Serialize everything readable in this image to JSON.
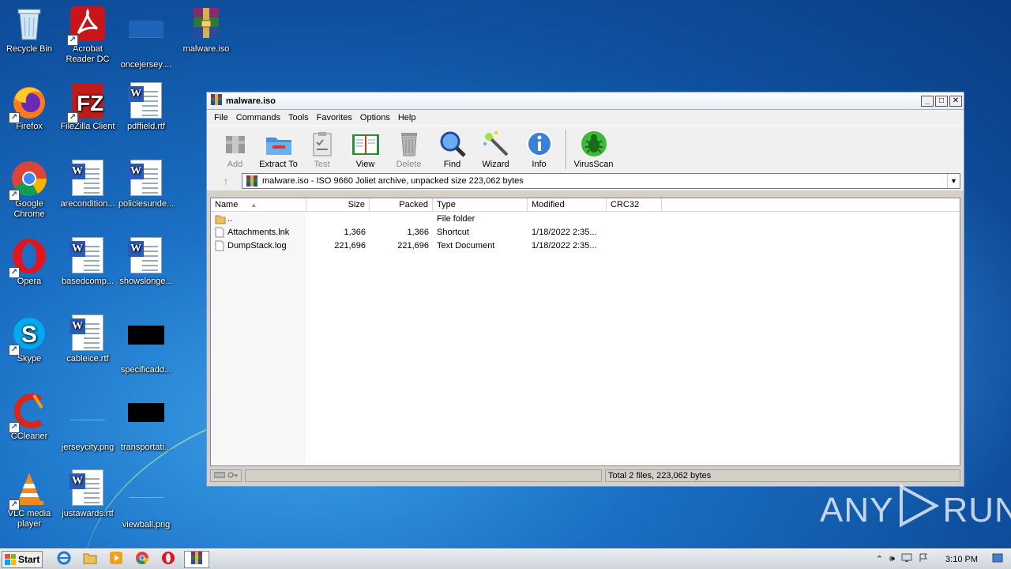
{
  "desktop": {
    "icons": [
      {
        "label": "Recycle Bin"
      },
      {
        "label": "Acrobat Reader DC"
      },
      {
        "label": "oncejersey...."
      },
      {
        "label": "malware.iso"
      },
      {
        "label": "Firefox"
      },
      {
        "label": "FileZilla Client"
      },
      {
        "label": "pdffield.rtf"
      },
      {
        "label": "Google Chrome"
      },
      {
        "label": "arecondition..."
      },
      {
        "label": "policiesunde..."
      },
      {
        "label": "Opera"
      },
      {
        "label": "basedcomp..."
      },
      {
        "label": "showslonge..."
      },
      {
        "label": "Skype"
      },
      {
        "label": "cableice.rtf"
      },
      {
        "label": "specificadd..."
      },
      {
        "label": "CCleaner"
      },
      {
        "label": "jerseycity.png"
      },
      {
        "label": "transportati..."
      },
      {
        "label": "VLC media player"
      },
      {
        "label": "justawards.rtf"
      },
      {
        "label": "viewball.png"
      }
    ]
  },
  "window": {
    "title": "malware.iso",
    "menu": [
      "File",
      "Commands",
      "Tools",
      "Favorites",
      "Options",
      "Help"
    ],
    "toolbar": [
      {
        "label": "Add",
        "enabled": false,
        "icon": "add-icon"
      },
      {
        "label": "Extract To",
        "enabled": true,
        "icon": "extract-folder-icon"
      },
      {
        "label": "Test",
        "enabled": false,
        "icon": "test-clipboard-icon"
      },
      {
        "label": "View",
        "enabled": true,
        "icon": "book-icon"
      },
      {
        "label": "Delete",
        "enabled": false,
        "icon": "trash-icon"
      },
      {
        "label": "Find",
        "enabled": true,
        "icon": "magnifier-icon"
      },
      {
        "label": "Wizard",
        "enabled": true,
        "icon": "wand-icon"
      },
      {
        "label": "Info",
        "enabled": true,
        "icon": "info-icon"
      },
      {
        "label": "VirusScan",
        "enabled": true,
        "icon": "bug-icon"
      }
    ],
    "address": "malware.iso - ISO 9660 Joliet archive, unpacked size 223,062 bytes",
    "columns": [
      "Name",
      "Size",
      "Packed",
      "Type",
      "Modified",
      "CRC32"
    ],
    "rows": [
      {
        "name": "..",
        "size": "",
        "packed": "",
        "type": "File folder",
        "modified": "",
        "crc": "",
        "icon": "folder-icon"
      },
      {
        "name": "Attachments.lnk",
        "size": "1,366",
        "packed": "1,366",
        "type": "Shortcut",
        "modified": "1/18/2022 2:35...",
        "crc": "",
        "icon": "file-icon"
      },
      {
        "name": "DumpStack.log",
        "size": "221,696",
        "packed": "221,696",
        "type": "Text Document",
        "modified": "1/18/2022 2:35...",
        "crc": "",
        "icon": "file-icon"
      }
    ],
    "status": "Total 2 files, 223,062 bytes"
  },
  "taskbar": {
    "start_label": "Start",
    "clock": "3:10 PM"
  },
  "watermark": {
    "left": "ANY",
    "right": "RUN"
  },
  "colors": {
    "desktop": "#1a6fc4",
    "window_bg": "#d4d0c8",
    "accent": "#2b5db8"
  }
}
